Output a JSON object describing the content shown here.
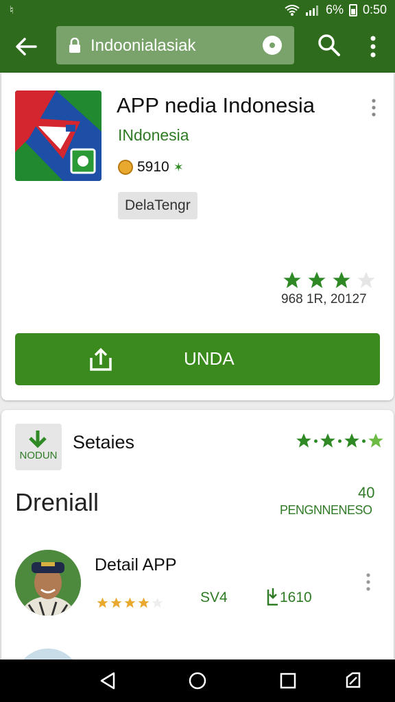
{
  "status_bar": {
    "battery": "6%",
    "time": "0:50"
  },
  "toolbar": {
    "url": "Indoonialasiak"
  },
  "app": {
    "title": "APP nedia Indonesia",
    "developer": "INdonesia",
    "rating": "5910",
    "tag": "DelaTengr",
    "stars": 3,
    "review_meta": "968 1R, 20127",
    "install_label": "UNDA"
  },
  "section": {
    "icon_label": "NODUN",
    "title": "Setaies",
    "heading": "Dreniall",
    "count": "40",
    "count_label": "PENGNNENESO"
  },
  "detail": {
    "title": "Detail APP",
    "stars": 4,
    "score": "SV4",
    "downloads": "1610"
  },
  "colors": {
    "primary": "#2f6b1c",
    "accent_green": "#3a8a1e",
    "star_green": "#2f8a25",
    "star_gold": "#e8a92e"
  }
}
